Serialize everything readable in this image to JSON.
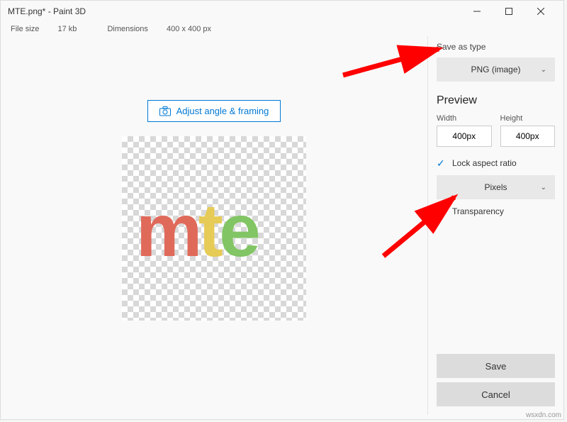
{
  "title": "MTE.png* - Paint 3D",
  "file_info": {
    "size_label": "File size",
    "size_value": "17 kb",
    "dim_label": "Dimensions",
    "dim_value": "400 x 400 px"
  },
  "adjust_label": "Adjust angle & framing",
  "canvas": {
    "m_color": "#e06a5a",
    "t_color": "#e6cb56",
    "e_color": "#82c564"
  },
  "sidebar": {
    "save_as_type_label": "Save as type",
    "format_selected": "PNG (image)",
    "preview_title": "Preview",
    "width_label": "Width",
    "height_label": "Height",
    "width_value": "400px",
    "height_value": "400px",
    "lock_aspect_label": "Lock aspect ratio",
    "units_selected": "Pixels",
    "transparency_label": "Transparency",
    "save_label": "Save",
    "cancel_label": "Cancel"
  },
  "watermark": "wsxdn.com"
}
